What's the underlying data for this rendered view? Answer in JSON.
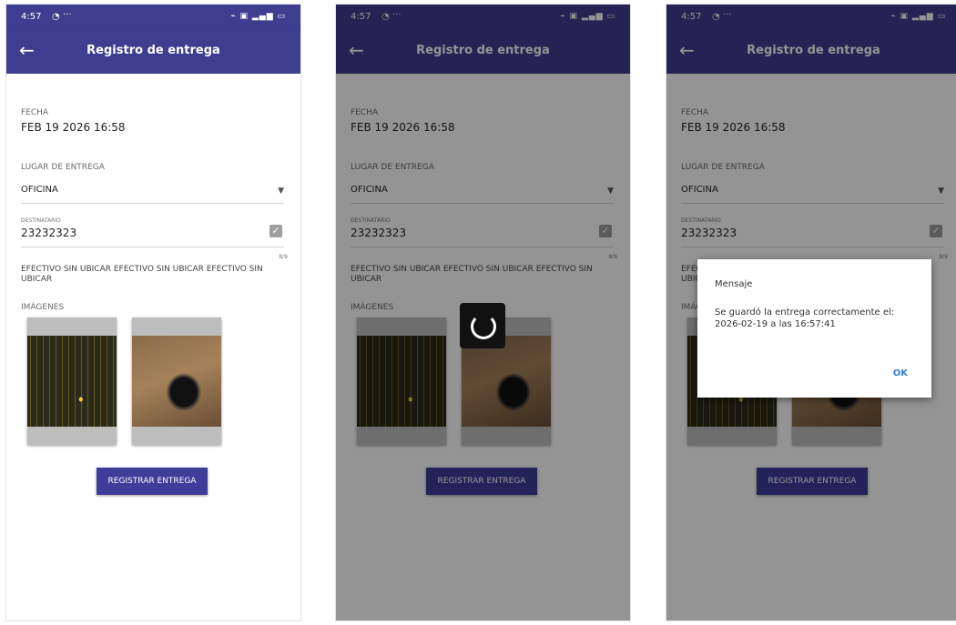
{
  "status": {
    "time": "4:57",
    "whatsapp_icon": "whatsapp-icon",
    "dots": "···",
    "right_icons": "signal-icons"
  },
  "appbar": {
    "back_icon": "arrow-left-icon",
    "title": "Registro de entrega"
  },
  "form": {
    "fecha_label": "FECHA",
    "fecha_value": "FEB 19 2026 16:58",
    "lugar_label": "LUGAR DE ENTREGA",
    "lugar_value": "OFICINA",
    "destinatario_label": "DESTINATARIO",
    "destinatario_value": "23232323",
    "counter": "8/9",
    "observacion": "EFECTIVO SIN UBICAR EFECTIVO SIN UBICAR EFECTIVO SIN UBICAR",
    "imagenes_label": "IMÁGENES",
    "submit_label": "REGISTRAR ENTREGA"
  },
  "dialog": {
    "title": "Mensaje",
    "message": "Se guardó la entrega correctamente el: 2026-02-19 a las 16:57:41",
    "ok_label": "OK"
  },
  "colors": {
    "primary": "#3f3d8f",
    "button": "#3f3d9a",
    "dialog_ok": "#2d7fd3"
  }
}
